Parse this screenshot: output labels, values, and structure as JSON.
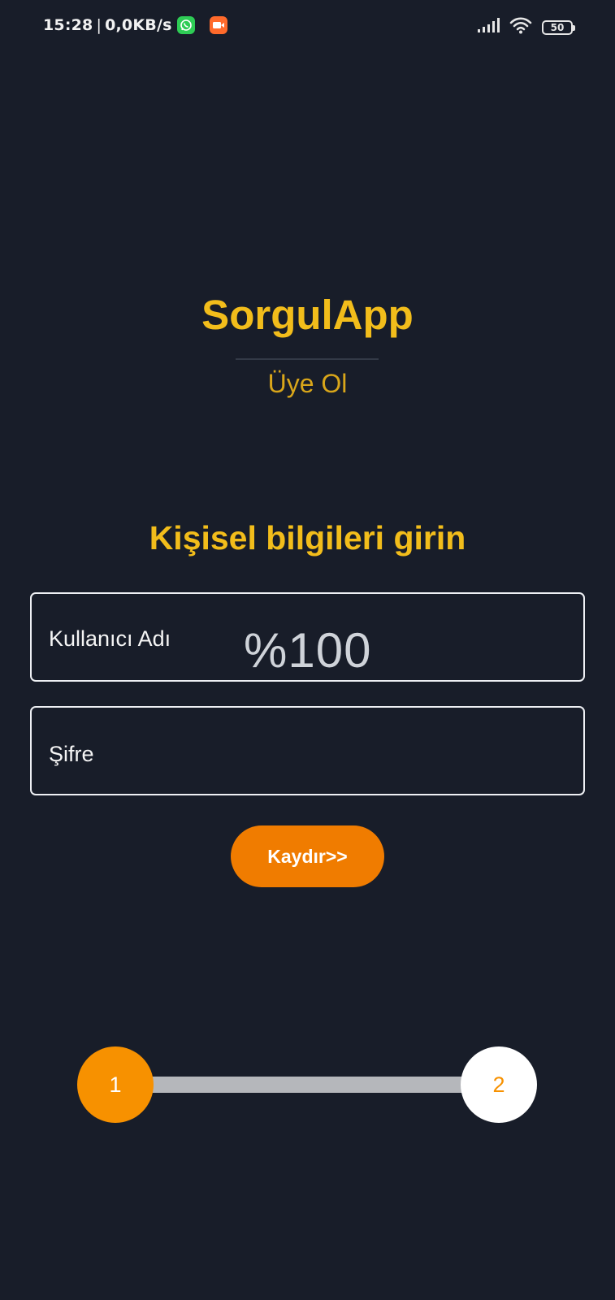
{
  "status_bar": {
    "time": "15:28",
    "separator": "|",
    "network_speed": "0,0KB/s",
    "battery_level": "50",
    "icons": [
      "whatsapp-icon",
      "video-recorder-icon",
      "signal-icon",
      "wifi-icon",
      "battery-icon"
    ]
  },
  "header": {
    "app_title": "SorgulApp",
    "subtitle": "Üye Ol"
  },
  "form": {
    "heading": "Kişisel bilgileri girin",
    "username_label": "Kullanıcı Adı",
    "username_value": "%100",
    "password_label": "Şifre"
  },
  "actions": {
    "scroll_button_label": "Kaydır>>"
  },
  "stepper": {
    "steps": [
      "1",
      "2"
    ],
    "current_step": 1
  },
  "colors": {
    "background": "#181d29",
    "accent_yellow": "#f2bd1b",
    "accent_orange": "#f07c00",
    "step_active": "#f79100"
  }
}
